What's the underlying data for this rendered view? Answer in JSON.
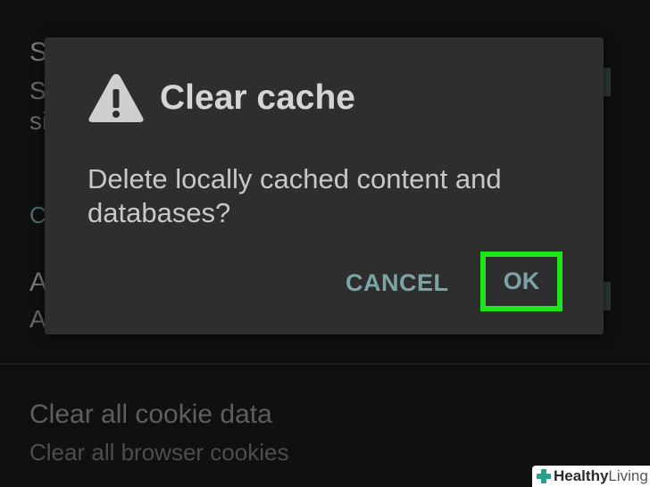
{
  "background": {
    "fragments": {
      "s_title": "S",
      "s_sub1": "S",
      "s_sub2": "si",
      "c_accent": "C",
      "a_title": "A",
      "a_sub": "A"
    },
    "clear_cookie": {
      "title": "Clear all cookie data",
      "subtitle": "Clear all browser cookies"
    }
  },
  "dialog": {
    "icon": "warning-icon",
    "title": "Clear cache",
    "message": "Delete locally cached content and databases?",
    "cancel_label": "CANCEL",
    "ok_label": "OK",
    "highlight_color": "#1ee61a"
  },
  "watermark": {
    "part1": "Healthy",
    "part2": "Living"
  }
}
